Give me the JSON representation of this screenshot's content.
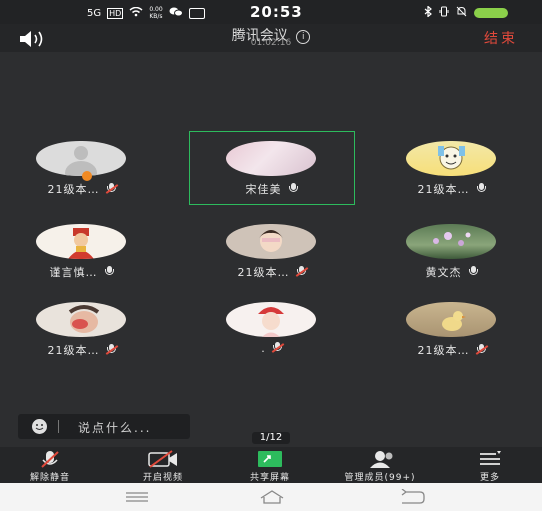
{
  "status": {
    "signal": "5G",
    "hd": "HD",
    "speed": "0.00 KB/s",
    "time": "20:53"
  },
  "header": {
    "title": "腾讯会议",
    "info_symbol": "i",
    "elapsed": "01:02:16",
    "end_label": "结束"
  },
  "participants": [
    {
      "name": "21级本…",
      "muted": true
    },
    {
      "name": "宋佳美",
      "muted": false,
      "selected": true
    },
    {
      "name": "21级本…",
      "muted": false
    },
    {
      "name": "谨言慎…",
      "muted": false
    },
    {
      "name": "21级本…",
      "muted": true
    },
    {
      "name": "黄文杰",
      "muted": false
    },
    {
      "name": "21级本…",
      "muted": true
    },
    {
      "name": ".",
      "muted": true
    },
    {
      "name": "21级本…",
      "muted": true
    }
  ],
  "chat": {
    "placeholder": "说点什么..."
  },
  "pager": "1/12",
  "toolbar": {
    "unmute": "解除静音",
    "start_video": "开启视频",
    "share_screen": "共享屏幕",
    "manage_members": "管理成员(99+)",
    "more": "更多"
  },
  "colors": {
    "accent_green": "#2dbb5d",
    "end_red": "#e0493b",
    "background": "#2d2e30"
  }
}
